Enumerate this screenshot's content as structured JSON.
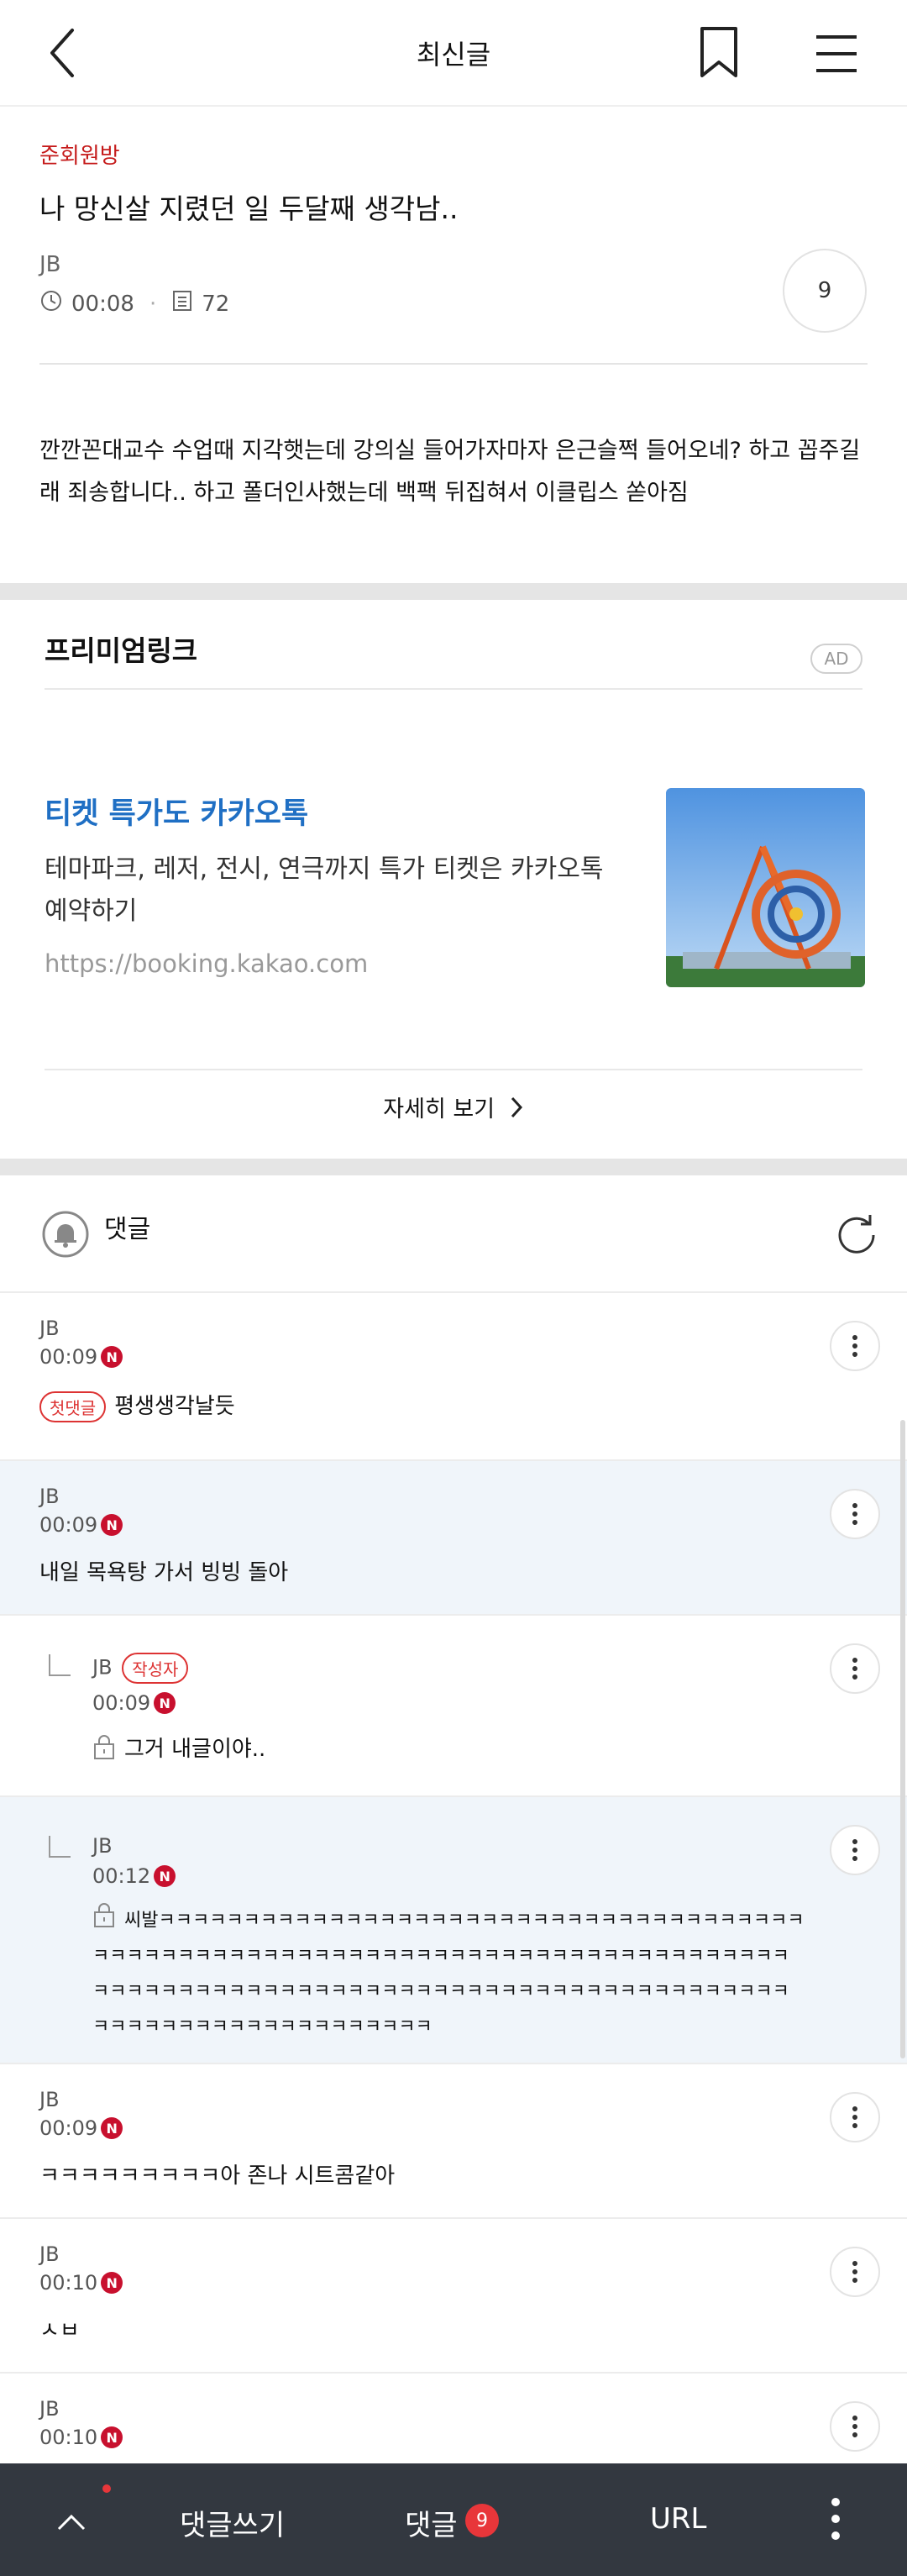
{
  "header": {
    "title": "최신글"
  },
  "post": {
    "category": "준회원방",
    "title": "나 망신살 지렸던 일 두달째 생각남..",
    "author": "JB",
    "time": "00:08",
    "views": "72",
    "comment_count": "9",
    "body": "깐깐꼰대교수 수업때 지각햇는데 강의실 들어가자마자 은근슬쩍 들어오네? 하고 꼽주길래 죄송합니다.. 하고 폴더인사했는데 백팩 뒤집혀서 이클립스 쏟아짐"
  },
  "ad": {
    "heading": "프리미엄링크",
    "badge": "AD",
    "title": "티켓 특가도 카카오톡",
    "description": "테마파크, 레저, 전시, 연극까지 특가 티켓은 카카오톡 예약하기",
    "url": "https://booking.kakao.com",
    "more_label": "자세히 보기"
  },
  "comments": {
    "title": "댓글",
    "new_badge": "N",
    "first_badge": "첫댓글",
    "writer_badge": "작성자",
    "items": [
      {
        "author": "JB",
        "time": "00:09",
        "text": "평생생각날듯"
      },
      {
        "author": "JB",
        "time": "00:09",
        "text": "내일 목욕탕 가서 빙빙 돌아"
      },
      {
        "author": "JB",
        "time": "00:09",
        "text": "그거 내글이야.."
      },
      {
        "author": "JB",
        "time": "00:12",
        "text": "씨발ㅋㅋㅋㅋㅋㅋㅋㅋㅋㅋㅋㅋㅋㅋㅋㅋㅋㅋㅋㅋㅋㅋㅋㅋㅋㅋㅋㅋㅋㅋㅋㅋㅋㅋㅋㅋㅋㅋㅋㅋㅋㅋㅋㅋㅋㅋㅋㅋㅋㅋㅋㅋㅋㅋㅋㅋㅋㅋㅋㅋㅋㅋㅋㅋㅋㅋㅋㅋㅋㅋㅋㅋㅋㅋㅋㅋㅋㅋㅋㅋㅋㅋㅋㅋㅋㅋㅋㅋㅋㅋㅋㅋㅋㅋㅋㅋㅋㅋㅋㅋㅋㅋㅋㅋㅋㅋㅋㅋㅋㅋㅋㅋㅋㅋㅋㅋㅋㅋㅋㅋㅋㅋㅋㅋㅋㅋㅋㅋㅋㅋㅋㅋㅋㅋㅋㅋㅋㅋㅋㅋ"
      },
      {
        "author": "JB",
        "time": "00:09",
        "text": "ㅋㅋㅋㅋㅋㅋㅋㅋㅋ아 존나 시트콤같아"
      },
      {
        "author": "JB",
        "time": "00:10",
        "text": "ㅅㅂ"
      },
      {
        "author": "JB",
        "time": "00:10",
        "text": ""
      }
    ]
  },
  "bottom_bar": {
    "write_label": "댓글쓰기",
    "comments_label": "댓글",
    "comments_count": "9",
    "url_label": "URL"
  },
  "colors": {
    "accent_red": "#c51a1a",
    "ad_blue": "#1f6fc4",
    "bottom_bar": "#333840",
    "highlight_row": "#f0f5fa"
  }
}
